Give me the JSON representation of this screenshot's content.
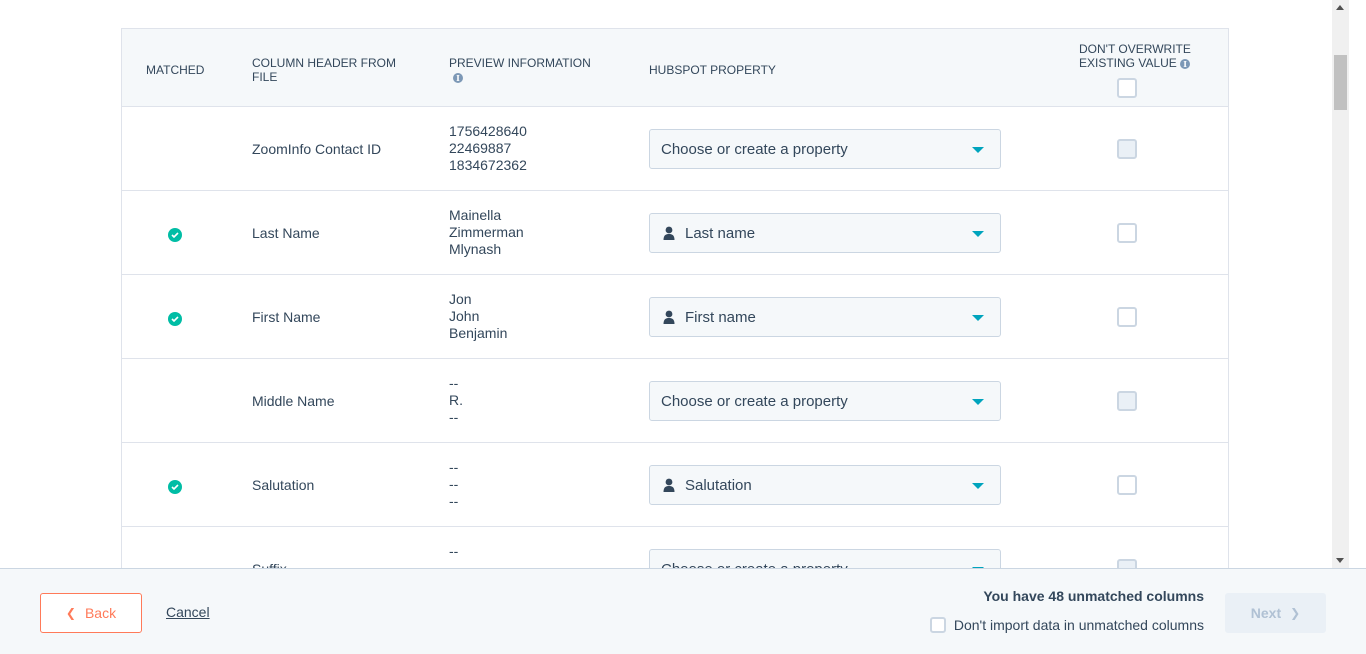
{
  "table": {
    "headers": {
      "matched": "MATCHED",
      "column_header": "COLUMN HEADER FROM FILE",
      "preview": "PREVIEW INFORMATION",
      "hubspot_property": "HUBSPOT PROPERTY",
      "dont_overwrite": "DON'T OVERWRITE EXISTING VALUE"
    },
    "rows": [
      {
        "matched": false,
        "column": "ZoomInfo Contact ID",
        "preview": [
          "1756428640",
          "22469887",
          "1834672362"
        ],
        "property": "Choose or create a property",
        "property_selected": false,
        "overwrite_disabled": true
      },
      {
        "matched": true,
        "column": "Last Name",
        "preview": [
          "Mainella",
          "Zimmerman",
          "Mlynash"
        ],
        "property": "Last name",
        "property_selected": true,
        "overwrite_disabled": false
      },
      {
        "matched": true,
        "column": "First Name",
        "preview": [
          "Jon",
          "John",
          "Benjamin"
        ],
        "property": "First name",
        "property_selected": true,
        "overwrite_disabled": false
      },
      {
        "matched": false,
        "column": "Middle Name",
        "preview": [
          "--",
          "R.",
          "--"
        ],
        "property": "Choose or create a property",
        "property_selected": false,
        "overwrite_disabled": true
      },
      {
        "matched": true,
        "column": "Salutation",
        "preview": [
          "--",
          "--",
          "--"
        ],
        "property": "Salutation",
        "property_selected": true,
        "overwrite_disabled": false
      },
      {
        "matched": false,
        "column": "Suffix",
        "preview": [
          "--"
        ],
        "property": "Choose or create a property",
        "property_selected": false,
        "overwrite_disabled": true
      }
    ]
  },
  "footer": {
    "back_label": "Back",
    "cancel_label": "Cancel",
    "unmatched_message": "You have 48 unmatched columns",
    "dont_import_label": "Don't import data in unmatched columns",
    "next_label": "Next"
  },
  "colors": {
    "accent_orange": "#ff7a59",
    "matched_green": "#00bda5",
    "caret_teal": "#00a4bd",
    "text_dark": "#33475b"
  }
}
